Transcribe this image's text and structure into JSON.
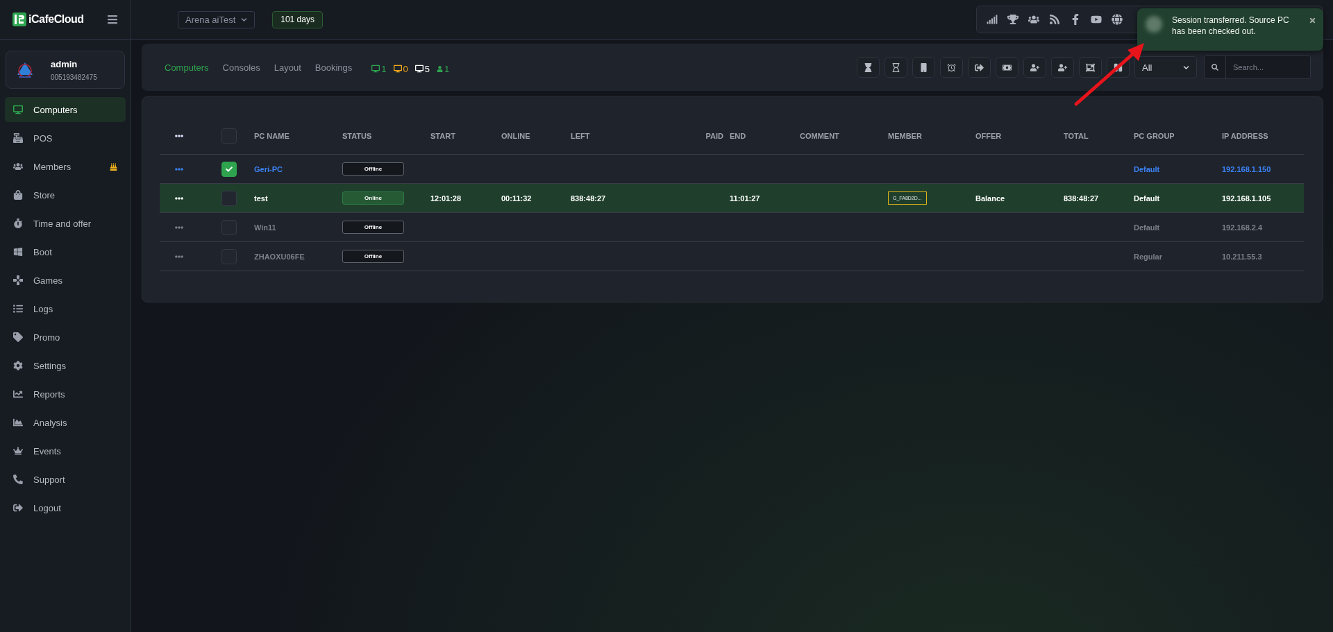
{
  "brand": {
    "name": "iCafeCloud"
  },
  "topbar": {
    "branch": "Arena aiTest",
    "days": "101 days"
  },
  "user": {
    "name": "admin",
    "id": "005193482475"
  },
  "sidebar": {
    "items": [
      {
        "label": "Computers",
        "selected": true,
        "notice": false
      },
      {
        "label": "POS",
        "selected": false,
        "notice": false
      },
      {
        "label": "Members",
        "selected": false,
        "notice": true
      },
      {
        "label": "Store",
        "selected": false,
        "notice": false
      },
      {
        "label": "Time and offer",
        "selected": false,
        "notice": false
      },
      {
        "label": "Boot",
        "selected": false,
        "notice": false
      },
      {
        "label": "Games",
        "selected": false,
        "notice": false
      },
      {
        "label": "Logs",
        "selected": false,
        "notice": false
      },
      {
        "label": "Promo",
        "selected": false,
        "notice": false
      },
      {
        "label": "Settings",
        "selected": false,
        "notice": false
      },
      {
        "label": "Reports",
        "selected": false,
        "notice": false
      },
      {
        "label": "Analysis",
        "selected": false,
        "notice": false
      },
      {
        "label": "Events",
        "selected": false,
        "notice": false
      },
      {
        "label": "Support",
        "selected": false,
        "notice": false
      },
      {
        "label": "Logout",
        "selected": false,
        "notice": false
      }
    ]
  },
  "tabs": [
    {
      "label": "Computers",
      "selected": true
    },
    {
      "label": "Consoles",
      "selected": false
    },
    {
      "label": "Layout",
      "selected": false
    },
    {
      "label": "Bookings",
      "selected": false
    }
  ],
  "counters": [
    {
      "kind": "monitor",
      "value": "1",
      "color": "#2ea44f"
    },
    {
      "kind": "monitor",
      "value": "0",
      "color": "#f0a81c"
    },
    {
      "kind": "monitor",
      "value": "5",
      "color": "#ffffff"
    },
    {
      "kind": "person",
      "value": "1",
      "color": "#2ea44f"
    }
  ],
  "filter": {
    "value": "All"
  },
  "search": {
    "placeholder": "Search..."
  },
  "table": {
    "select_all": {
      "checked": false
    },
    "columns": [
      "PC NAME",
      "STATUS",
      "START",
      "ONLINE",
      "LEFT",
      "PAID",
      "END",
      "COMMENT",
      "MEMBER",
      "OFFER",
      "TOTAL",
      "PC GROUP",
      "IP ADDRESS"
    ],
    "rows": [
      {
        "kind": "selected",
        "checked": true,
        "name": "Geri-PC",
        "status": "Offline",
        "online": false,
        "start": "",
        "online_time": "",
        "left": "",
        "paid": "",
        "end": "",
        "comment": "",
        "member": "",
        "offer": "",
        "total": "",
        "group": "Default",
        "ip": "192.168.1.150"
      },
      {
        "kind": "active",
        "checked": false,
        "name": "test",
        "status": "Online",
        "online": true,
        "start": "12:01:28",
        "online_time": "00:11:32",
        "left": "838:48:27",
        "paid": "",
        "end": "11:01:27",
        "comment": "",
        "member": "G_FA8D2D...",
        "offer": "Balance",
        "total": "838:48:27",
        "group": "Default",
        "ip": "192.168.1.105"
      },
      {
        "kind": "idle",
        "checked": false,
        "name": "Win11",
        "status": "Offline",
        "online": false,
        "start": "",
        "online_time": "",
        "left": "",
        "paid": "",
        "end": "",
        "comment": "",
        "member": "",
        "offer": "",
        "total": "",
        "group": "Default",
        "ip": "192.168.2.4"
      },
      {
        "kind": "idle",
        "checked": false,
        "name": "ZHAOXU06FE",
        "status": "Offline",
        "online": false,
        "start": "",
        "online_time": "",
        "left": "",
        "paid": "",
        "end": "",
        "comment": "",
        "member": "",
        "offer": "",
        "total": "",
        "group": "Regular",
        "ip": "10.211.55.3"
      }
    ]
  },
  "toast": {
    "message": "Session transferred. Source PC has been checked out."
  }
}
